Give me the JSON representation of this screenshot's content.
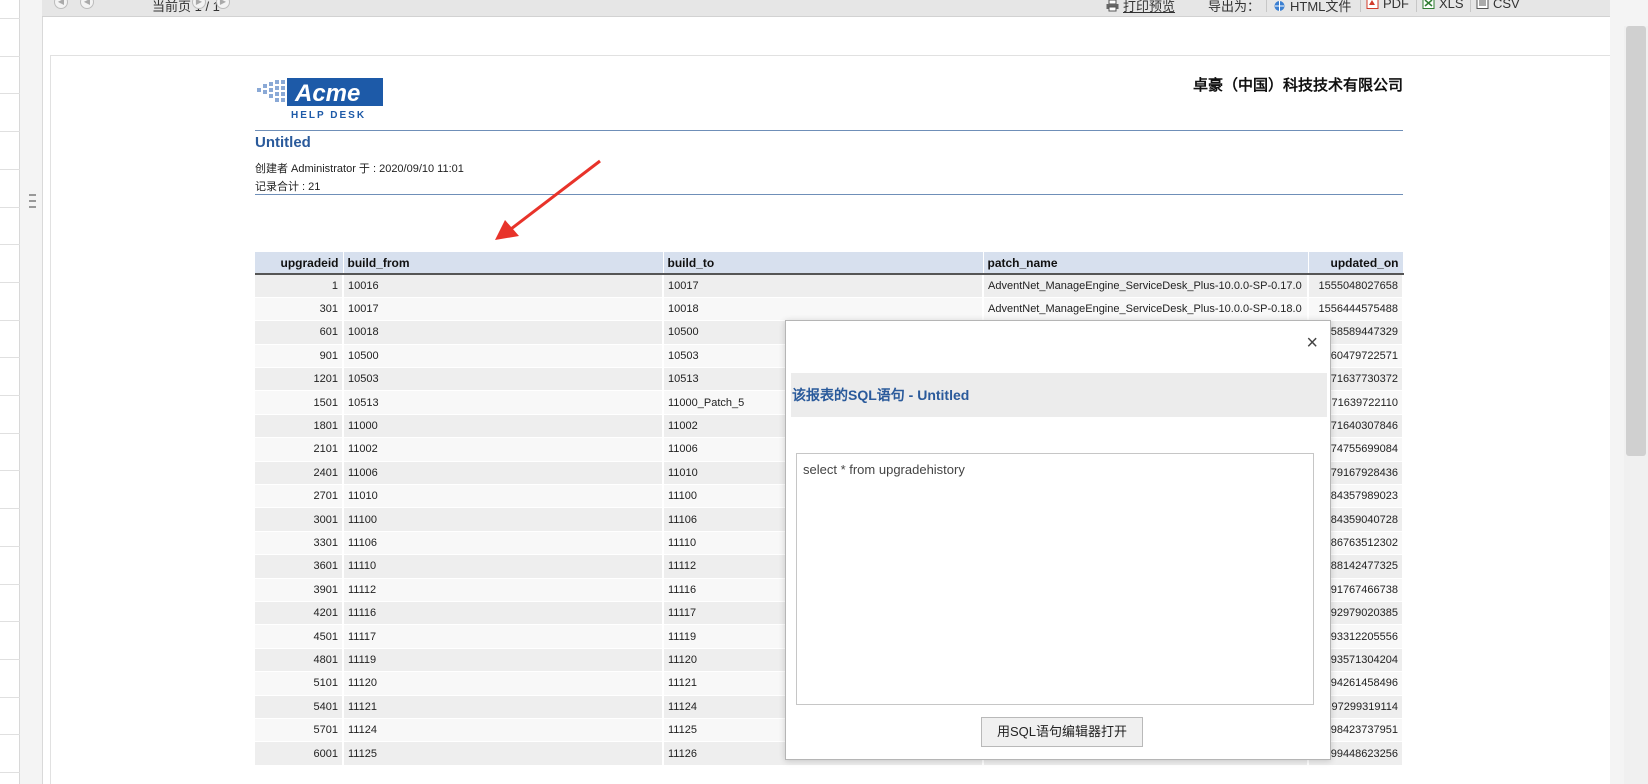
{
  "toolbar": {
    "page_info": "当前页 1 / 1",
    "print_label": "打印预览",
    "export_label": "导出为：",
    "export_html": "HTML文件",
    "export_pdf": "PDF",
    "export_xls": "XLS",
    "export_csv": "CSV"
  },
  "report": {
    "company": "卓豪（中国）科技技术有限公司",
    "title": "Untitled",
    "created_by": "创建者 Administrator  于 : 2020/09/10 11:01",
    "record_count": "记录合计 : 21",
    "logo_text": "Acme",
    "logo_subtext": "HELP DESK"
  },
  "table": {
    "headers": [
      "upgradeid",
      "build_from",
      "build_to",
      "patch_name",
      "updated_on"
    ],
    "rows": [
      [
        "1",
        "10016",
        "10017",
        "AdventNet_ManageEngine_ServiceDesk_Plus-10.0.0-SP-0.17.0",
        "1555048027658"
      ],
      [
        "301",
        "10017",
        "10018",
        "AdventNet_ManageEngine_ServiceDesk_Plus-10.0.0-SP-0.18.0",
        "1556444575488"
      ],
      [
        "601",
        "10018",
        "10500",
        "",
        "58589447329"
      ],
      [
        "901",
        "10500",
        "10503",
        "",
        "60479722571"
      ],
      [
        "1201",
        "10503",
        "10513",
        "",
        "71637730372"
      ],
      [
        "1501",
        "10513",
        "11000_Patch_5",
        "",
        "71639722110"
      ],
      [
        "1801",
        "11000",
        "11002",
        "",
        "71640307846"
      ],
      [
        "2101",
        "11002",
        "11006",
        "",
        "74755699084"
      ],
      [
        "2401",
        "11006",
        "11010",
        "",
        "79167928436"
      ],
      [
        "2701",
        "11010",
        "11100",
        "",
        "84357989023"
      ],
      [
        "3001",
        "11100",
        "11106",
        "",
        "84359040728"
      ],
      [
        "3301",
        "11106",
        "11110",
        "",
        "86763512302"
      ],
      [
        "3601",
        "11110",
        "11112",
        "",
        "88142477325"
      ],
      [
        "3901",
        "11112",
        "11116",
        "",
        "91767466738"
      ],
      [
        "4201",
        "11116",
        "11117",
        "",
        "92979020385"
      ],
      [
        "4501",
        "11117",
        "11119",
        "",
        "93312205556"
      ],
      [
        "4801",
        "11119",
        "11120",
        "",
        "93571304204"
      ],
      [
        "5101",
        "11120",
        "11121",
        "",
        "94261458496"
      ],
      [
        "5401",
        "11121",
        "11124",
        "",
        "97299319114"
      ],
      [
        "5701",
        "11124",
        "11125",
        "",
        "98423737951"
      ],
      [
        "6001",
        "11125",
        "11126",
        "",
        "99448623256"
      ]
    ]
  },
  "dialog": {
    "close": "×",
    "title": "该报表的SQL语句 - Untitled",
    "sql": "select * from upgradehistory",
    "open_button": "用SQL语句编辑器打开"
  },
  "colors": {
    "accent": "#2a5a9b",
    "header_bg": "#d7e0ee",
    "arrow": "#e8332a"
  }
}
